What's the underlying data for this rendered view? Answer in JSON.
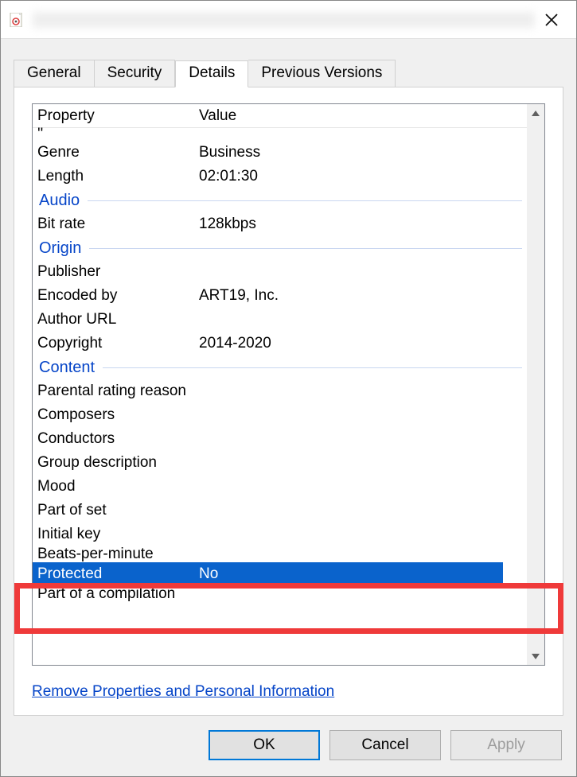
{
  "titlebar": {
    "close_title": "Close"
  },
  "tabs": {
    "general": "General",
    "security": "Security",
    "details": "Details",
    "previous": "Previous Versions"
  },
  "header": {
    "property": "Property",
    "value": "Value"
  },
  "sections": {
    "audio": "Audio",
    "origin": "Origin",
    "content": "Content"
  },
  "rows": {
    "prime": {
      "label": "'' ",
      "value": ""
    },
    "genre": {
      "label": "Genre",
      "value": "Business"
    },
    "length": {
      "label": "Length",
      "value": "02:01:30"
    },
    "bitrate": {
      "label": "Bit rate",
      "value": "128kbps"
    },
    "publisher": {
      "label": "Publisher",
      "value": ""
    },
    "encodedby": {
      "label": "Encoded by",
      "value": "ART19, Inc."
    },
    "authorurl": {
      "label": "Author URL",
      "value": ""
    },
    "copyright": {
      "label": "Copyright",
      "value": "2014-2020"
    },
    "parental": {
      "label": "Parental rating reason",
      "value": ""
    },
    "composers": {
      "label": "Composers",
      "value": ""
    },
    "conductors": {
      "label": "Conductors",
      "value": ""
    },
    "groupdesc": {
      "label": "Group description",
      "value": ""
    },
    "mood": {
      "label": "Mood",
      "value": ""
    },
    "partofset": {
      "label": "Part of set",
      "value": ""
    },
    "initialkey": {
      "label": "Initial key",
      "value": ""
    },
    "bpm": {
      "label": "Beats-per-minute",
      "value": ""
    },
    "protected": {
      "label": "Protected",
      "value": "No"
    },
    "partofcomp": {
      "label": "Part of a compilation",
      "value": ""
    }
  },
  "link": "Remove Properties and Personal Information",
  "buttons": {
    "ok": "OK",
    "cancel": "Cancel",
    "apply": "Apply"
  }
}
